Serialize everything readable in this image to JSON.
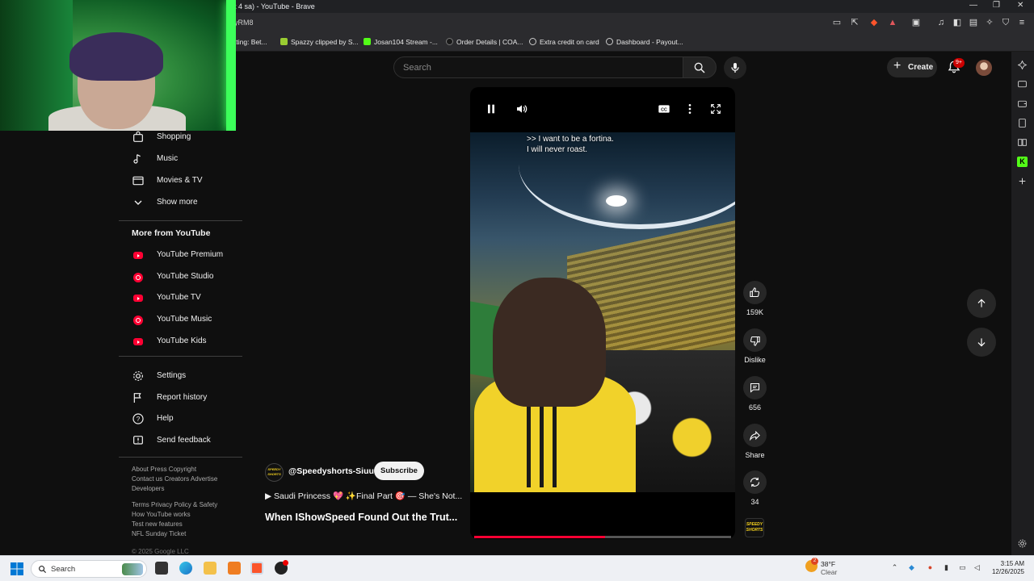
{
  "browser": {
    "title": "t 4 sa) - YouTube - Brave",
    "url_fragment": "yRM8",
    "bookmarks": [
      {
        "label": "tting: Bet...",
        "color": "#cccccc"
      },
      {
        "label": "Spazzy clipped by S...",
        "color": "#9acd32"
      },
      {
        "label": "Josan104 Stream -...",
        "color": "#53fc18"
      },
      {
        "label": "Order Details | COA...",
        "color": "#1a1a1a"
      },
      {
        "label": "Extra credit on card",
        "color": "#d0d0d0"
      },
      {
        "label": "Dashboard - Payout...",
        "color": "#d0d0d0"
      }
    ]
  },
  "masthead": {
    "search_placeholder": "Search",
    "create_label": "Create",
    "notification_count": "9+"
  },
  "sidebar": {
    "explore_items": [
      {
        "label": "Shopping",
        "icon": "shopping-bag-icon"
      },
      {
        "label": "Music",
        "icon": "music-note-icon"
      },
      {
        "label": "Movies & TV",
        "icon": "clapperboard-icon"
      },
      {
        "label": "Show more",
        "icon": "chevron-down-icon"
      }
    ],
    "more_heading": "More from YouTube",
    "more_items": [
      {
        "label": "YouTube Premium",
        "icon": "youtube-premium-icon"
      },
      {
        "label": "YouTube Studio",
        "icon": "youtube-studio-icon"
      },
      {
        "label": "YouTube TV",
        "icon": "youtube-tv-icon"
      },
      {
        "label": "YouTube Music",
        "icon": "youtube-music-icon"
      },
      {
        "label": "YouTube Kids",
        "icon": "youtube-kids-icon"
      }
    ],
    "settings_items": [
      {
        "label": "Settings",
        "icon": "gear-icon"
      },
      {
        "label": "Report history",
        "icon": "flag-icon"
      },
      {
        "label": "Help",
        "icon": "help-icon"
      },
      {
        "label": "Send feedback",
        "icon": "feedback-icon"
      }
    ],
    "footer": {
      "line1": "About  Press  Copyright",
      "line2": "Contact us  Creators  Advertise",
      "line3": "Developers",
      "line4": "Terms  Privacy  Policy & Safety",
      "line5": "How YouTube works",
      "line6": "Test new features",
      "line7": "NFL Sunday Ticket",
      "copyright": "© 2025 Google LLC"
    }
  },
  "short": {
    "caption": ">> I want to be a fortina.\nI will never roast.",
    "progress_fraction": 0.51,
    "channel_handle": "@Speedyshorts-Siuu",
    "channel_logo_text": "SPEEDY SHORTS",
    "subscribe_label": "Subscribe",
    "playlist": "▶  Saudi Princess 💖 ✨Final Part 🎯 — She's Not...",
    "title": "When IShowSpeed Found Out the Trut..."
  },
  "actions": {
    "likes": "159K",
    "dislike": "Dislike",
    "comments": "656",
    "share": "Share",
    "remix": "34"
  },
  "taskbar": {
    "search_placeholder": "Search",
    "weather_temp": "38°F",
    "weather_desc": "Clear",
    "weather_badge": "2",
    "time": "3:15 AM",
    "date": "12/26/2025"
  }
}
